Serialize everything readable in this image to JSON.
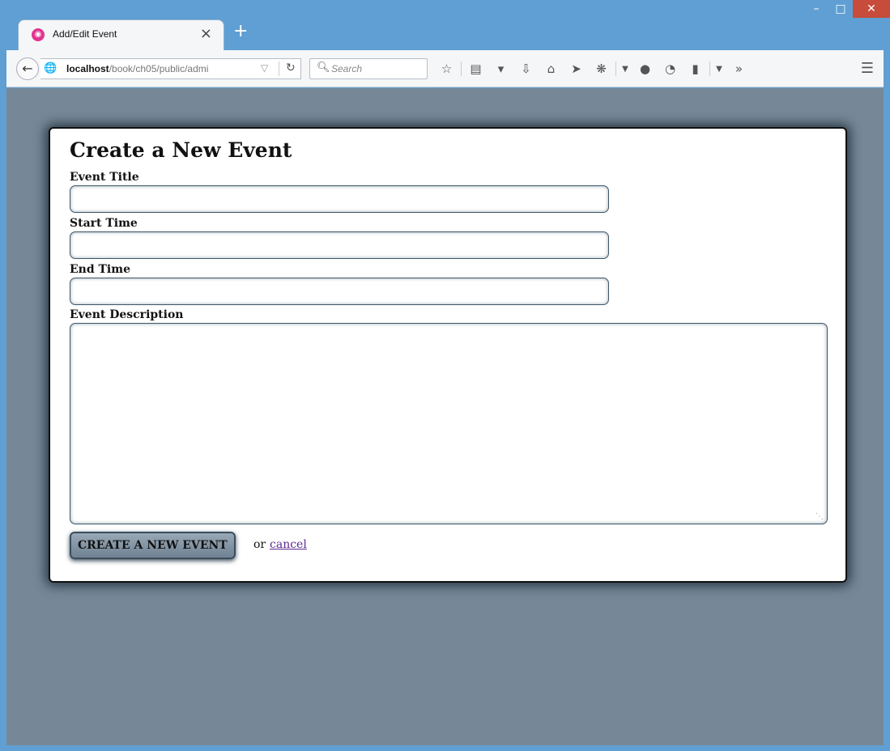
{
  "browser": {
    "tab_title": "Add/Edit Event",
    "tab_close_icon": "close-icon",
    "new_tab_icon": "plus-icon",
    "url_host": "localhost",
    "url_path": "/book/ch05/public/admi",
    "search_placeholder": "Search",
    "window_controls": {
      "minimize": "–",
      "maximize": "□",
      "close": "✕"
    }
  },
  "form": {
    "heading": "Create a New Event",
    "event_title_label": "Event Title",
    "event_title_value": "",
    "start_time_label": "Start Time",
    "start_time_value": "",
    "end_time_label": "End Time",
    "end_time_value": "",
    "description_label": "Event Description",
    "description_value": "",
    "submit_label": "Create a New Event",
    "or_text": "or",
    "cancel_label": "cancel"
  },
  "colors": {
    "window_frame": "#5f9fd3",
    "page_background": "#768897",
    "button_gradient": "#98a8b6",
    "link": "#5b2a93"
  }
}
